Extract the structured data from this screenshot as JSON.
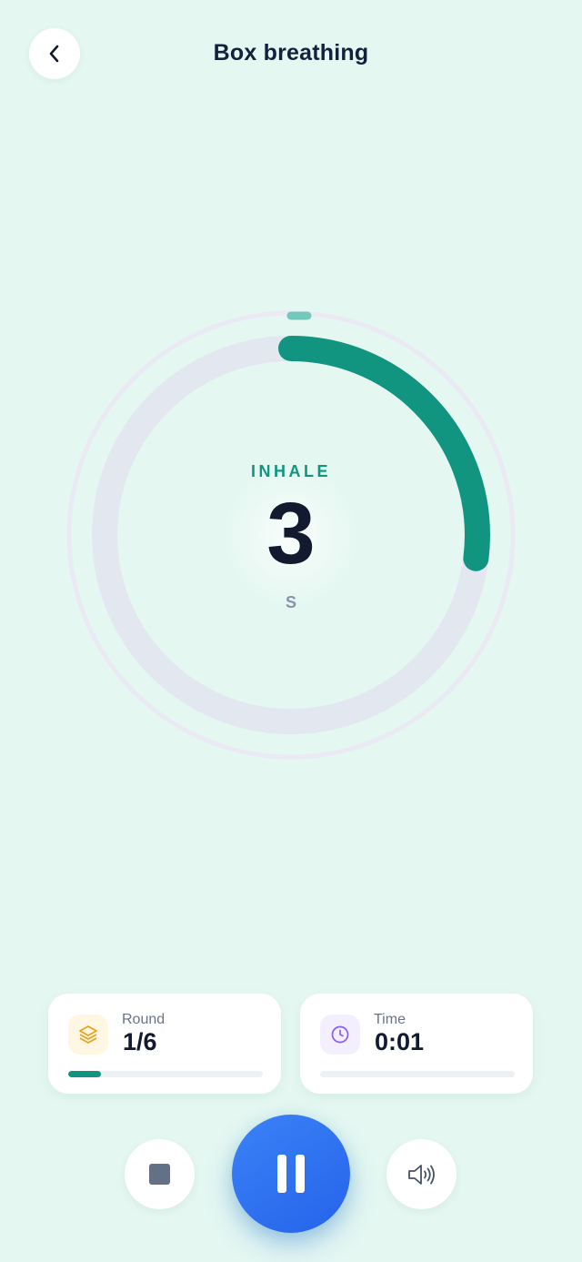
{
  "header": {
    "title": "Box breathing",
    "back_icon": "chevron-left-icon"
  },
  "breathing": {
    "phase": "INHALE",
    "count": "3",
    "unit": "S",
    "phase_progress": 0.27,
    "accent_color": "#119580"
  },
  "stats": {
    "round": {
      "label": "Round",
      "value": "1/6",
      "progress": 0.17,
      "icon": "layers-icon",
      "icon_color": "#e9a21a"
    },
    "time": {
      "label": "Time",
      "value": "0:01",
      "progress": 0,
      "icon": "clock-icon",
      "icon_color": "#8b5cf6"
    }
  },
  "controls": {
    "stop_icon": "stop-icon",
    "pause_icon": "pause-icon",
    "sound_icon": "volume-icon",
    "primary_color": "#2563eb"
  }
}
